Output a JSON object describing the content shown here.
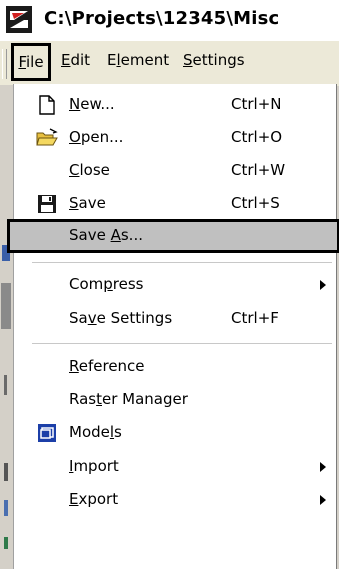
{
  "window": {
    "title": "C:\\Projects\\12345\\Misc"
  },
  "menubar": {
    "items": [
      {
        "label": "File",
        "mnemonic": "F"
      },
      {
        "label": "Edit",
        "mnemonic": "E"
      },
      {
        "label": "Element",
        "mnemonic": "l"
      },
      {
        "label": "Settings",
        "mnemonic": "S"
      }
    ]
  },
  "file_menu": {
    "items": [
      {
        "label_pre": "",
        "mn": "N",
        "label_post": "ew...",
        "shortcut": "Ctrl+N",
        "icon": "new-document-icon"
      },
      {
        "label_pre": "",
        "mn": "O",
        "label_post": "pen...",
        "shortcut": "Ctrl+O",
        "icon": "open-folder-icon"
      },
      {
        "label_pre": "",
        "mn": "C",
        "label_post": "lose",
        "shortcut": "Ctrl+W",
        "icon": ""
      },
      {
        "label_pre": "",
        "mn": "S",
        "label_post": "ave",
        "shortcut": "Ctrl+S",
        "icon": "save-disk-icon"
      },
      {
        "label_pre": "Save ",
        "mn": "A",
        "label_post": "s...",
        "shortcut": "",
        "icon": "",
        "highlighted": true
      },
      {
        "label_pre": "Com",
        "mn": "p",
        "label_post": "ress",
        "shortcut": "",
        "icon": "",
        "submenu": true
      },
      {
        "label_pre": "Sa",
        "mn": "v",
        "label_post": "e Settings",
        "shortcut": "Ctrl+F",
        "icon": ""
      },
      {
        "label_pre": "",
        "mn": "R",
        "label_post": "eference",
        "shortcut": "",
        "icon": ""
      },
      {
        "label_pre": "Ras",
        "mn": "t",
        "label_post": "er Manager",
        "shortcut": "",
        "icon": ""
      },
      {
        "label_pre": "Mode",
        "mn": "l",
        "label_post": "s",
        "shortcut": "",
        "icon": "models-icon"
      },
      {
        "label_pre": "",
        "mn": "I",
        "label_post": "mport",
        "shortcut": "",
        "icon": "",
        "submenu": true
      },
      {
        "label_pre": "",
        "mn": "E",
        "label_post": "xport",
        "shortcut": "",
        "icon": "",
        "submenu": true
      }
    ]
  },
  "colors": {
    "menu_background": "#ffffff",
    "highlight_background": "#c0c0c0",
    "highlight_border": "#000000",
    "models_icon_blue": "#1c3fa8"
  }
}
